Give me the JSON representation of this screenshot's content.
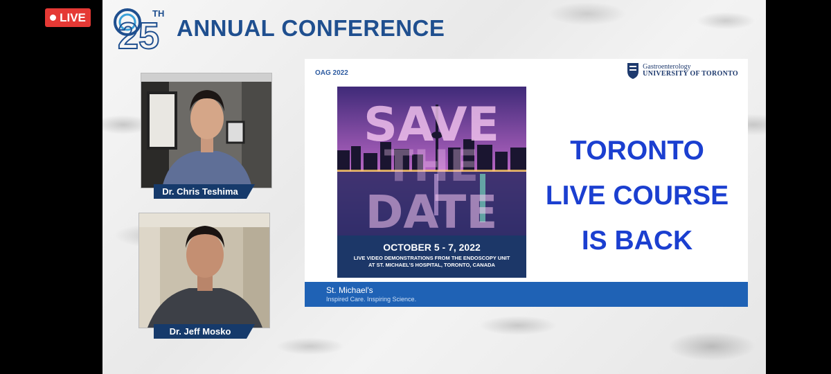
{
  "live_label": "LIVE",
  "conference": {
    "number": "25",
    "superscript": "TH",
    "title": "ANNUAL CONFERENCE"
  },
  "speakers": [
    {
      "name": "Dr. Chris Teshima"
    },
    {
      "name": "Dr. Jeff Mosko"
    }
  ],
  "slide": {
    "tag": "OAG 2022",
    "university_line1": "Gastroenterology",
    "university_line2": "UNIVERSITY OF TORONTO",
    "poster_words": [
      "SAVE",
      "THE",
      "DATE"
    ],
    "poster_date": "OCTOBER 5 - 7, 2022",
    "poster_sub1": "LIVE VIDEO DEMONSTRATIONS FROM THE ENDOSCOPY UNIT",
    "poster_sub2": "AT ST. MICHAEL'S HOSPITAL, TORONTO, CANADA",
    "headline": [
      "TORONTO",
      "LIVE COURSE",
      "IS BACK"
    ],
    "hospital_name": "St. Michael's",
    "hospital_tagline": "Inspired Care. Inspiring Science."
  },
  "colors": {
    "brand_blue": "#1f4f8f",
    "live_red": "#e53935",
    "headline_blue": "#1b3fd0",
    "footer_blue": "#1f62b5"
  }
}
